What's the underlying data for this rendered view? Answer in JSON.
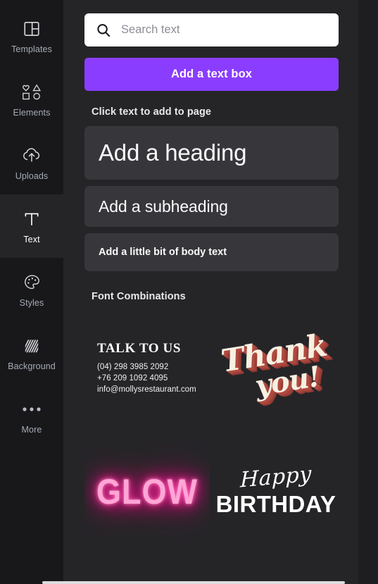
{
  "colors": {
    "sidebar_bg": "#18181a",
    "panel_bg": "#252528",
    "card_bg": "#37373b",
    "accent_purple": "#8b3dff",
    "label_gray": "#a6abb5",
    "neon_pink": "#ffa6d6",
    "neon_glow": "#ff1493",
    "thank_cream": "#f7f1e2",
    "thank_shadow": "#b04b41"
  },
  "sidebar": {
    "items": [
      {
        "label": "Templates",
        "icon": "templates-icon",
        "active": false
      },
      {
        "label": "Elements",
        "icon": "elements-icon",
        "active": false
      },
      {
        "label": "Uploads",
        "icon": "uploads-icon",
        "active": false
      },
      {
        "label": "Text",
        "icon": "text-icon",
        "active": true
      },
      {
        "label": "Styles",
        "icon": "styles-icon",
        "active": false
      },
      {
        "label": "Background",
        "icon": "background-icon",
        "active": false
      },
      {
        "label": "More",
        "icon": "more-icon",
        "active": false
      }
    ]
  },
  "panel": {
    "search": {
      "placeholder": "Search text",
      "value": "",
      "icon": "search-icon"
    },
    "cta_label": "Add a text box",
    "click_text_heading": "Click text to add to page",
    "presets": [
      {
        "label": "Add a heading"
      },
      {
        "label": "Add a subheading"
      },
      {
        "label": "Add a little bit of body text"
      }
    ],
    "combinations_heading": "Font Combinations",
    "combinations": [
      {
        "name": "talk-to-us",
        "headline": "TALK TO US",
        "lines": [
          "(04) 298 3985 2092",
          "+76 209 1092 4095",
          "info@mollysrestaurant.com"
        ]
      },
      {
        "name": "thank-you",
        "word1": "Thank",
        "word2": "you!"
      },
      {
        "name": "glow",
        "word": "GLOW"
      },
      {
        "name": "happy-birthday",
        "script": "Happy",
        "bold": "BIRTHDAY"
      }
    ]
  }
}
